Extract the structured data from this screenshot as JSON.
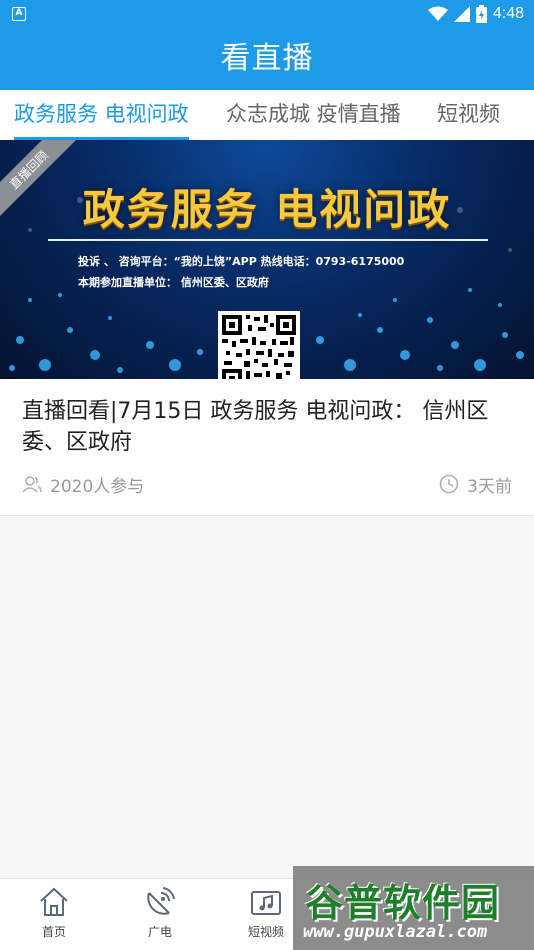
{
  "status_bar": {
    "time": "4:48",
    "app_icon_letter": "A",
    "icons": [
      "wifi-icon",
      "cell-signal-icon",
      "battery-icon"
    ]
  },
  "app_bar": {
    "title": "看直播"
  },
  "tabs": [
    {
      "label": "政务服务 电视问政",
      "active": true
    },
    {
      "label": "众志成城 疫情直播",
      "active": false
    },
    {
      "label": "短视频",
      "active": false
    }
  ],
  "card": {
    "banner": {
      "ribbon": "直播回顾",
      "headline": "政务服务 电视问政",
      "line1": "投诉 、 咨询平台：“我的上饶”APP      热线电话：0793-6175000",
      "line2": "本期参加直播单位：   信州区委、区政府",
      "colors": {
        "headline": "#f6c93e",
        "background": "#072a63"
      }
    },
    "title": "直播回看|7月15日 政务服务 电视问政： 信州区委、区政府",
    "participants": "2020人参与",
    "time_ago": "3天前"
  },
  "bottom_nav": [
    {
      "label": "首页",
      "icon": "home-icon"
    },
    {
      "label": "广电",
      "icon": "satellite-dish-icon"
    },
    {
      "label": "短视频",
      "icon": "music-video-icon"
    }
  ],
  "watermark": {
    "brand": "谷普软件园",
    "url": "www.gupuxlazal.com"
  },
  "theme": {
    "primary": "#1e9be8"
  }
}
